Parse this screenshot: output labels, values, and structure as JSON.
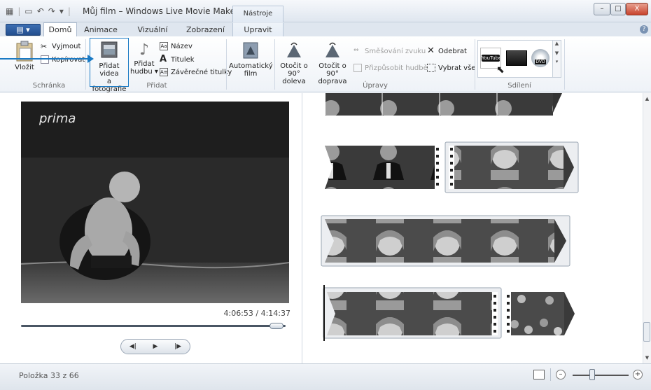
{
  "window": {
    "title": "Můj film – Windows Live Movie Maker",
    "context_tab_group": "Nástroje videa",
    "buttons": {
      "minimize": "–",
      "maximize": "□",
      "close": "X"
    }
  },
  "tabs": {
    "file": "▤ ▾",
    "home": "Domů",
    "animations": "Animace",
    "visual_effects": "Vizuální efekty",
    "view": "Zobrazení",
    "edit": "Upravit"
  },
  "ribbon": {
    "clipboard": {
      "label": "Schránka",
      "paste": "Vložit",
      "cut": "Vyjmout",
      "copy": "Kopírovat"
    },
    "add": {
      "label": "Přidat",
      "add_videos_line1": "Přidat videa",
      "add_videos_line2": "a fotografie",
      "add_music_line1": "Přidat",
      "add_music_line2": "hudbu ▾",
      "title": "Název",
      "caption": "Titulek",
      "credits": "Závěrečné titulky"
    },
    "automovie_line1": "Automatický",
    "automovie_line2": "film",
    "edits": {
      "label": "Úpravy",
      "rotate_left_line1": "Otočit o",
      "rotate_left_line2": "90° doleva",
      "rotate_right_line1": "Otočit o",
      "rotate_right_line2": "90° doprava",
      "audio_mix": "Směšování zvuku",
      "fit_to_music": "Přizpůsobit hudbě",
      "remove": "Odebrat",
      "select_all": "Vybrat vše"
    },
    "sharing": {
      "label": "Sdílení",
      "youtube": "YouTube",
      "dvd": "DVD"
    }
  },
  "preview": {
    "watermark": "prima",
    "timecode": "4:06:53 / 4:14:37",
    "progress": 0.965,
    "controls": {
      "prev": "◀|",
      "play": "▶",
      "next": "|▶"
    }
  },
  "status": {
    "item_count": "Položka 33 z 66",
    "zoom_minus": "–",
    "zoom_plus": "+",
    "zoom_level": 0.35
  },
  "colors": {
    "accent": "#1a7ac4",
    "ribbon_bg": "#eef2f7"
  }
}
